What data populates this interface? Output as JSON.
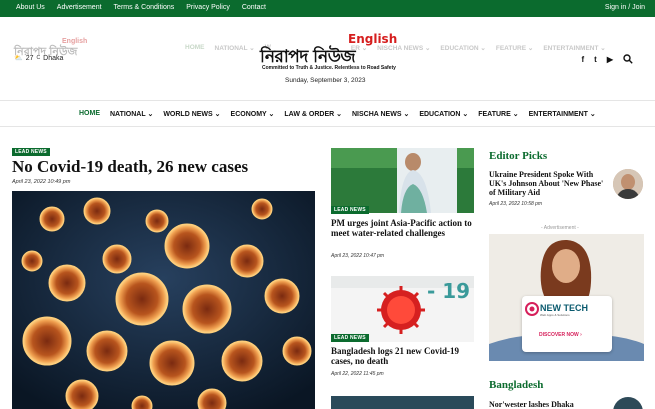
{
  "topbar": {
    "links": [
      "About Us",
      "Advertisement",
      "Terms & Conditions",
      "Privacy Policy",
      "Contact"
    ],
    "signin": "Sign in / Join"
  },
  "ghost_logo": {
    "bn": "নিরাপদ নিউজ",
    "en": "English"
  },
  "weather": {
    "temp": "27",
    "unit": "C",
    "city": "Dhaka"
  },
  "ghost_nav": [
    "HOME",
    "NATIONAL ⌄",
    "W",
    "ER ⌄",
    "NISCHA NEWS ⌄",
    "EDUCATION ⌄",
    "FEATURE ⌄",
    "ENTERTAINMENT ⌄"
  ],
  "logo": {
    "en": "English",
    "bn": "নিরাপদ নিউজ",
    "tagline": "Committed to Truth & Justice. Relentless to Road Safety"
  },
  "date": "Sunday, September 3, 2023",
  "social": [
    "f",
    "t",
    "▶"
  ],
  "nav": [
    {
      "label": "HOME",
      "active": true
    },
    {
      "label": "NATIONAL ⌄"
    },
    {
      "label": "WORLD NEWS ⌄"
    },
    {
      "label": "ECONOMY ⌄"
    },
    {
      "label": "LAW & ORDER ⌄"
    },
    {
      "label": "NISCHA NEWS ⌄"
    },
    {
      "label": "EDUCATION ⌄"
    },
    {
      "label": "FEATURE ⌄"
    },
    {
      "label": "ENTERTAINMENT ⌄"
    }
  ],
  "lead": {
    "badge": "LEAD NEWS",
    "title": "No Covid-19 death, 26 new cases",
    "date": "April 23, 2022 10:49 pm"
  },
  "middle": [
    {
      "badge": "LEAD NEWS",
      "title": "PM urges joint Asia-Pacific action to meet water-related challenges",
      "date": "April 23, 2022 10:47 pm"
    },
    {
      "badge": "LEAD NEWS",
      "title": "Bangladesh logs 21 new Covid-19 cases, no death",
      "date": "April 22, 2022 11:45 pm",
      "img_text": "- 19"
    }
  ],
  "editor_picks": {
    "title": "Editor Picks",
    "item": {
      "title": "Ukraine President Spoke With UK's Johnson About 'New Phase' of Military Aid",
      "date": "April 23, 2022 10:58 pm"
    }
  },
  "ad": {
    "label": "- Advertisement -",
    "brand": "NEW TECH",
    "sub": "Web Apps & Solutions",
    "cta": "DISCOVER NOW ›"
  },
  "bangladesh": {
    "title": "Bangladesh",
    "item": "Nor'wester lashes Dhaka"
  },
  "colors": {
    "accent": "#0b6b2e",
    "brand_red": "#d61f1f"
  }
}
